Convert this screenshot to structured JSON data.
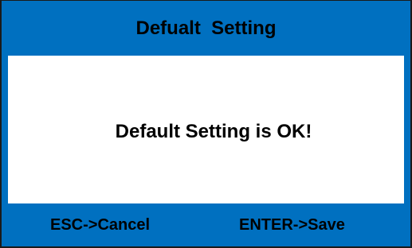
{
  "dialog": {
    "title": "Defualt  Setting",
    "message": "Default Setting is OK!",
    "footer": {
      "cancel_hint": "ESC->Cancel",
      "save_hint": "ENTER->Save"
    }
  },
  "colors": {
    "frame_blue": "#0070c0",
    "panel_white": "#ffffff",
    "text": "#000000"
  }
}
